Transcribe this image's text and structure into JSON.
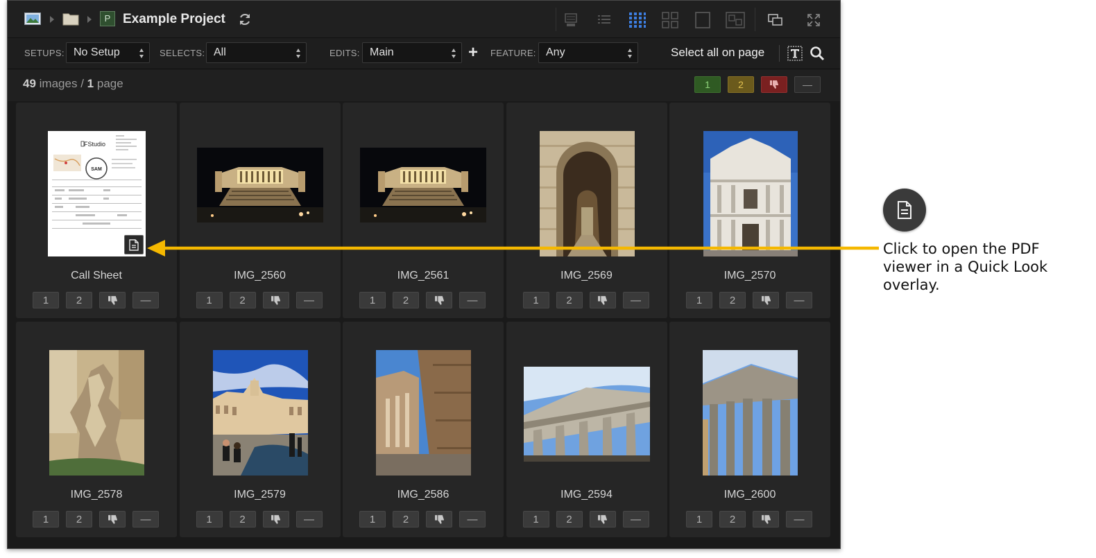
{
  "header": {
    "project_title": "Example Project",
    "project_badge": "P"
  },
  "filters": {
    "setups_label": "SETUPS:",
    "setups_value": "No Setup",
    "selects_label": "SELECTS:",
    "selects_value": "All",
    "edits_label": "EDITS:",
    "edits_value": "Main",
    "feature_label": "FEATURE:",
    "feature_value": "Any",
    "add_label": "+",
    "select_all_label": "Select all on page"
  },
  "status": {
    "image_count": "49",
    "images_word": "images",
    "separator": "/",
    "page_count": "1",
    "page_word": "page"
  },
  "rating_labels": {
    "one": "1",
    "two": "2",
    "dash": "—"
  },
  "colors": {
    "flag_green": "#2f5a23",
    "flag_yellow": "#6b5a1c",
    "flag_red": "#7a2020",
    "accent_arrow": "#f5b800",
    "grid_icon_blue": "#3d7ee0"
  },
  "items": [
    {
      "name": "Call Sheet",
      "kind": "pdf"
    },
    {
      "name": "IMG_2560",
      "kind": "night"
    },
    {
      "name": "IMG_2561",
      "kind": "night"
    },
    {
      "name": "IMG_2569",
      "kind": "arch"
    },
    {
      "name": "IMG_2570",
      "kind": "church"
    },
    {
      "name": "IMG_2578",
      "kind": "statue"
    },
    {
      "name": "IMG_2579",
      "kind": "piazza"
    },
    {
      "name": "IMG_2586",
      "kind": "ruin"
    },
    {
      "name": "IMG_2594",
      "kind": "pantheon"
    },
    {
      "name": "IMG_2600",
      "kind": "columns"
    }
  ],
  "pdf_preview": {
    "logo": "FStudio",
    "stamp": "SAM"
  },
  "callout": {
    "text": "Click to open the PDF viewer in a Quick Look overlay.",
    "icon": "document-icon"
  }
}
